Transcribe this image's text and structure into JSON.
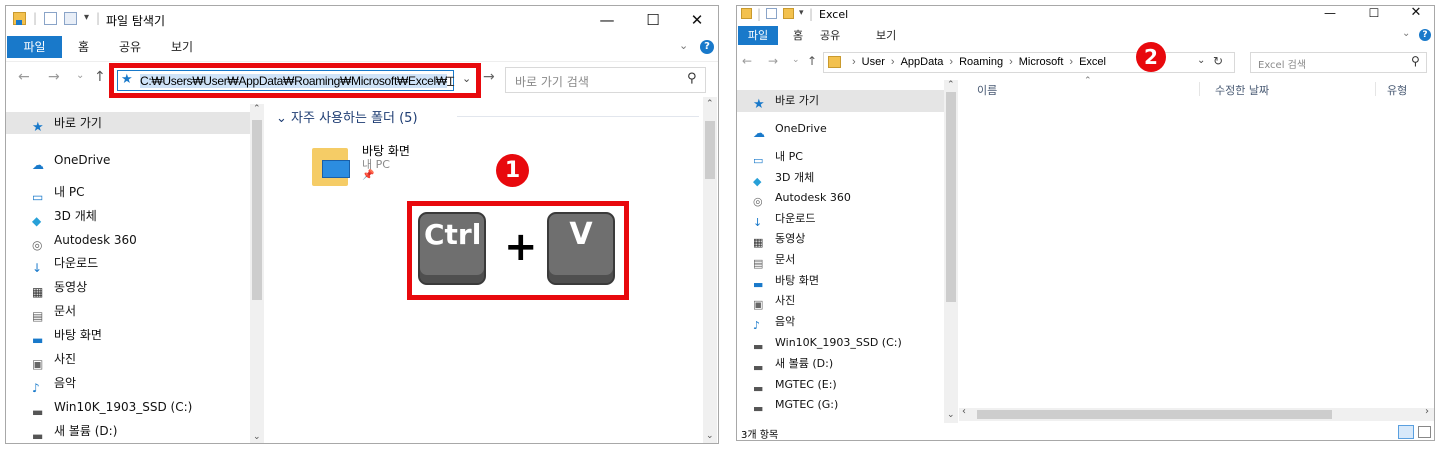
{
  "left_window": {
    "title": "파일 탐색기",
    "ribbon_tabs": [
      "파일",
      "홈",
      "공유",
      "보기"
    ],
    "address_value": "C:₩Users₩User₩AppData₩Roaming₩Microsoft₩Excel₩",
    "search_placeholder": "바로 가기 검색",
    "section_header": "자주 사용하는 폴더 (5)",
    "folder_tile": {
      "name": "바탕 화면",
      "location": "내 PC"
    },
    "shortcut_keys": {
      "key1": "Ctrl",
      "plus": "+",
      "key2": "V"
    },
    "step_badge": "1",
    "nav_items": [
      {
        "label": "바로 가기",
        "icon": "star-icon"
      },
      {
        "label": "OneDrive",
        "icon": "cloud-icon"
      },
      {
        "label": "내 PC",
        "icon": "computer-icon"
      },
      {
        "label": "3D 개체",
        "icon": "cube-icon"
      },
      {
        "label": "Autodesk 360",
        "icon": "autodesk-icon"
      },
      {
        "label": "다운로드",
        "icon": "download-icon"
      },
      {
        "label": "동영상",
        "icon": "video-icon"
      },
      {
        "label": "문서",
        "icon": "document-icon"
      },
      {
        "label": "바탕 화면",
        "icon": "desktop-icon"
      },
      {
        "label": "사진",
        "icon": "pictures-icon"
      },
      {
        "label": "음악",
        "icon": "music-icon"
      },
      {
        "label": "Win10K_1903_SSD (C:)",
        "icon": "drive-icon"
      },
      {
        "label": "새 볼륨 (D:)",
        "icon": "drive-icon"
      }
    ]
  },
  "right_window": {
    "title": "Excel",
    "ribbon_tabs": [
      "파일",
      "홈",
      "공유",
      "보기"
    ],
    "breadcrumb": [
      "User",
      "AppData",
      "Roaming",
      "Microsoft",
      "Excel"
    ],
    "search_placeholder": "Excel 검색",
    "step_badge": "2",
    "columns": [
      "이름",
      "수정한 날짜",
      "유형"
    ],
    "status": "3개 항목",
    "nav_items": [
      {
        "label": "바로 가기",
        "icon": "star-icon"
      },
      {
        "label": "OneDrive",
        "icon": "cloud-icon"
      },
      {
        "label": "내 PC",
        "icon": "computer-icon"
      },
      {
        "label": "3D 개체",
        "icon": "cube-icon"
      },
      {
        "label": "Autodesk 360",
        "icon": "autodesk-icon"
      },
      {
        "label": "다운로드",
        "icon": "download-icon"
      },
      {
        "label": "동영상",
        "icon": "video-icon"
      },
      {
        "label": "문서",
        "icon": "document-icon"
      },
      {
        "label": "바탕 화면",
        "icon": "desktop-icon"
      },
      {
        "label": "사진",
        "icon": "pictures-icon"
      },
      {
        "label": "음악",
        "icon": "music-icon"
      },
      {
        "label": "Win10K_1903_SSD (C:)",
        "icon": "drive-icon"
      },
      {
        "label": "새 볼륨 (D:)",
        "icon": "drive-icon"
      },
      {
        "label": "MGTEC (E:)",
        "icon": "drive-icon"
      },
      {
        "label": "MGTEC (G:)",
        "icon": "drive-icon"
      }
    ]
  },
  "colors": {
    "accent": "#1979ca",
    "highlight": "#e8090d",
    "selected": "#e5e5e5"
  }
}
